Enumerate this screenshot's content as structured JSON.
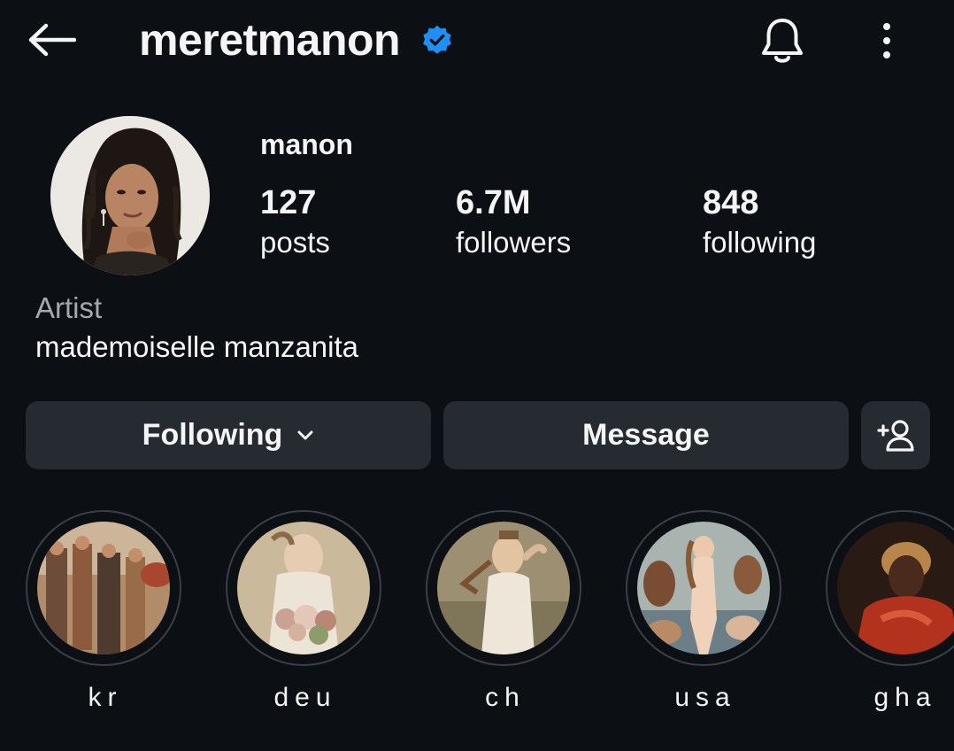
{
  "header": {
    "username": "meretmanon",
    "verified": true,
    "icons": {
      "back": "arrow-left-icon",
      "verified": "verified-badge-icon",
      "bell": "bell-icon",
      "more": "more-vertical-icon"
    }
  },
  "profile": {
    "display_name": "manon",
    "stats": [
      {
        "value": "127",
        "label": "posts"
      },
      {
        "value": "6.7M",
        "label": "followers"
      },
      {
        "value": "848",
        "label": "following"
      }
    ],
    "category": "Artist",
    "bio": "mademoiselle manzanita"
  },
  "actions": {
    "following_label": "Following",
    "message_label": "Message",
    "icons": {
      "following_dropdown": "chevron-down-icon",
      "add_user": "add-user-icon"
    }
  },
  "highlights": [
    {
      "label": "kr"
    },
    {
      "label": "deu"
    },
    {
      "label": "ch"
    },
    {
      "label": "usa"
    },
    {
      "label": "gha"
    }
  ],
  "colors": {
    "background": "#0c0f14",
    "button": "#262a31",
    "verified": "#1f8ff5",
    "muted_text": "#a5a8ae"
  }
}
